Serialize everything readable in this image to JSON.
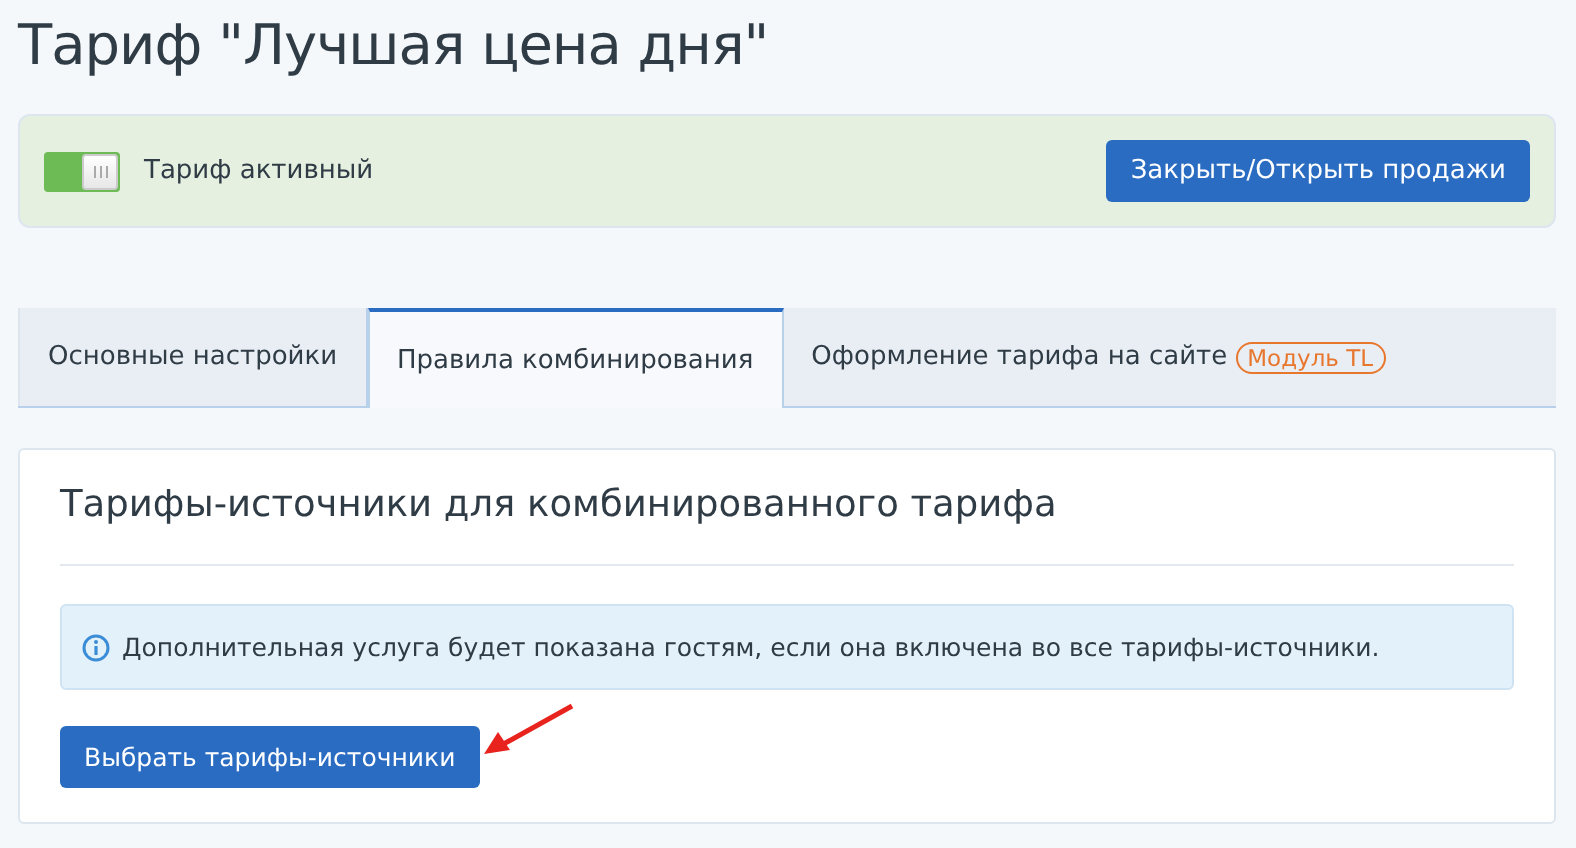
{
  "title": "Тариф \"Лучшая цена дня\"",
  "status_panel": {
    "toggle": {
      "label": "Тариф активный",
      "on": true
    },
    "button": "Закрыть/Открыть продажи"
  },
  "tabs": [
    {
      "label": "Основные настройки",
      "selected": false
    },
    {
      "label": "Правила комбинирования",
      "selected": true
    },
    {
      "label": "Оформление тарифа на сайте",
      "selected": false,
      "badge": "Модуль TL"
    }
  ],
  "card": {
    "heading": "Тарифы-источники для комбинированного тарифа",
    "info": "Дополнительная услуга будет показана гостям, если она включена во все тарифы-источники.",
    "button": "Выбрать тарифы-источники"
  }
}
